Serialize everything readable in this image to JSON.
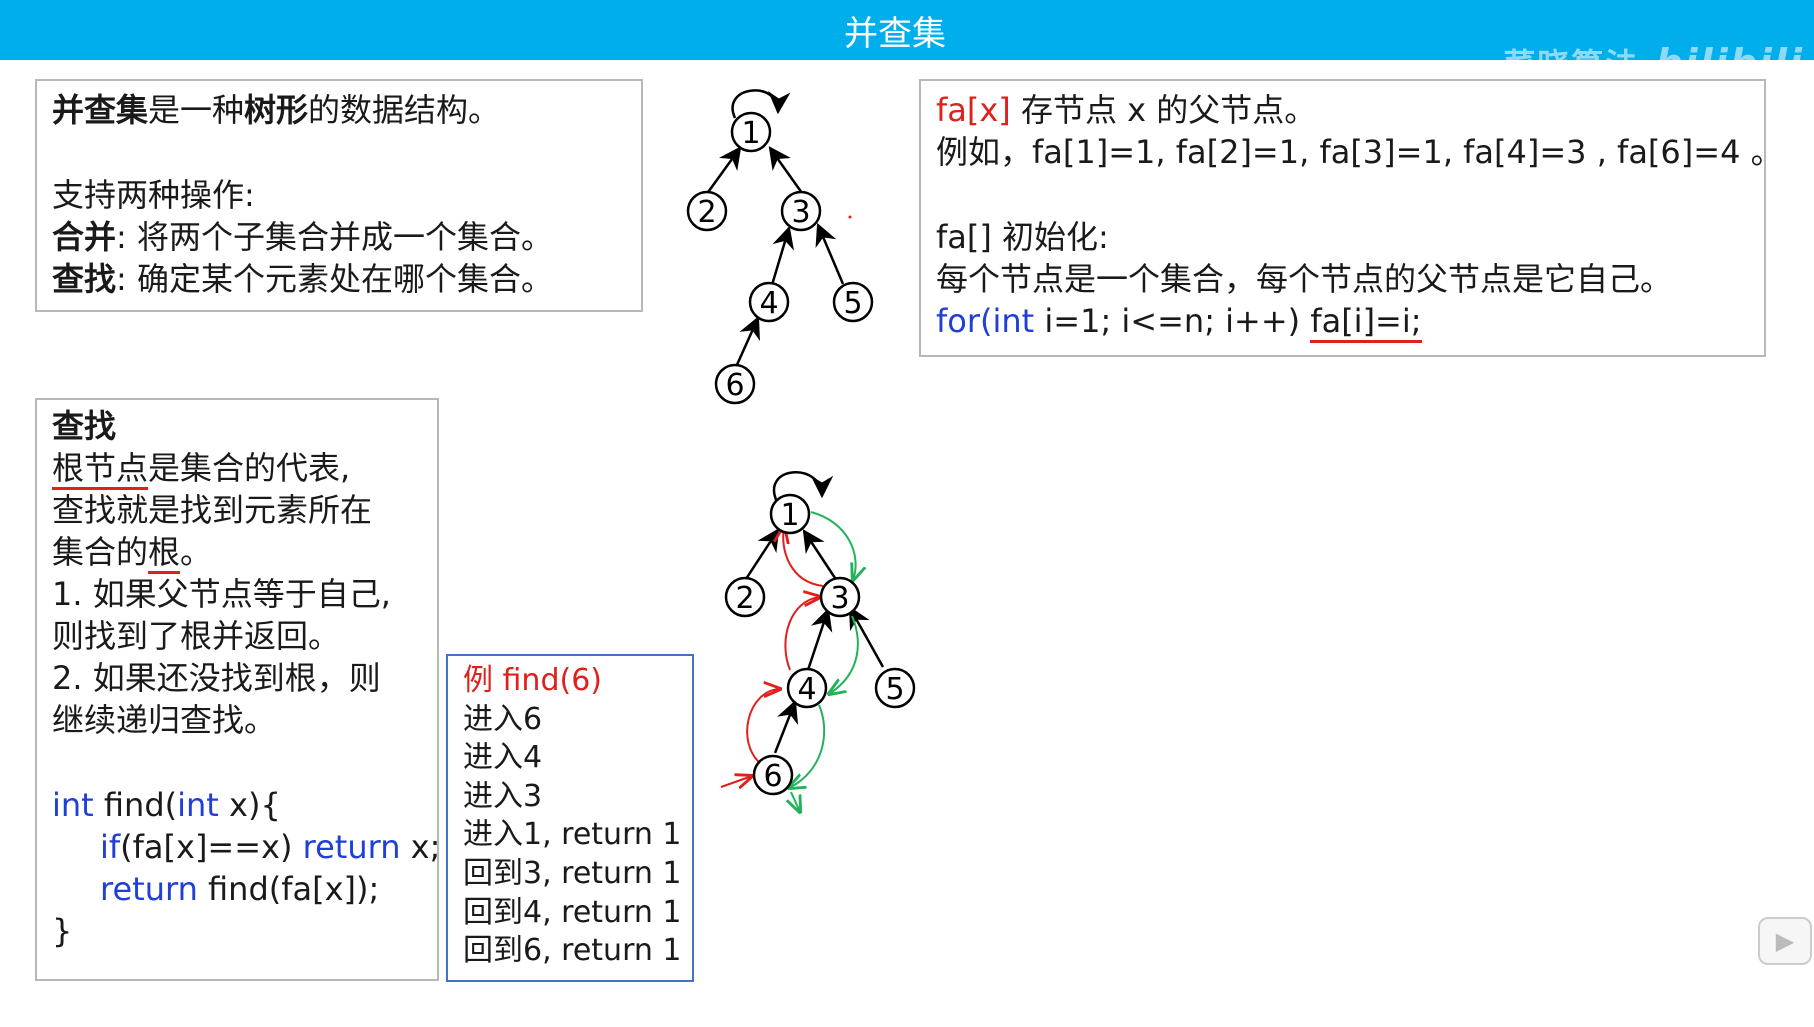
{
  "title": "并查集",
  "watermark": {
    "text": "菜晓算法",
    "logo": "bilibili"
  },
  "intro": {
    "line1_b1": "并查集",
    "line1_t1": "是一种",
    "line1_b2": "树形",
    "line1_t2": "的数据结构。",
    "line2": "支持两种操作:",
    "line3_b": "合并",
    "line3_t": ":  将两个子集合并成一个集合。",
    "line4_b": "查找",
    "line4_t": ":  确定某个元素处在哪个集合。"
  },
  "fa_box": {
    "l1_red": "fa[x]",
    "l1_rest": " 存节点 x 的父节点。",
    "l2": "例如，fa[1]=1, fa[2]=1, fa[3]=1, fa[4]=3 , fa[6]=4 。",
    "l3": "fa[] 初始化:",
    "l4": "每个节点是一个集合，每个节点的父节点是它自己。",
    "l5_kw1": "for",
    "l5_p1": "(",
    "l5_kw2": "int",
    "l5_p2": " i=1; i<=n; i++) ",
    "l5_u": "fa[i]=i;"
  },
  "find_box": {
    "heading": "查找",
    "l1_u": "根节点",
    "l1_t": "是集合的代表,",
    "l2": "查找就是找到元素所在",
    "l3_t": "集合的",
    "l3_u": "根",
    "l3_end": "。",
    "l4": "1. 如果父节点等于自己,",
    "l5": "则找到了根并返回。",
    "l6": "2. 如果还没找到根，则",
    "l7": "继续递归查找。",
    "c1_kw1": "int",
    "c1_t1": " find(",
    "c1_kw2": "int",
    "c1_t2": " x){",
    "c2_kw": "if",
    "c2_t1": "(fa[x]==x) ",
    "c2_kw2": "return",
    "c2_t2": " x;",
    "c3_kw": "return",
    "c3_t": " find(fa[x]);",
    "c4": "}"
  },
  "example_box": {
    "head": "例 find(6)",
    "steps": [
      "进入6",
      "进入4",
      "进入3",
      "进入1, return 1",
      "回到3, return 1",
      "回到4, return 1",
      "回到6, return 1"
    ]
  },
  "tree1": {
    "nodes": [
      "1",
      "2",
      "3",
      "4",
      "5",
      "6"
    ]
  },
  "tree2": {
    "nodes": [
      "1",
      "2",
      "3",
      "4",
      "5",
      "6"
    ]
  },
  "colors": {
    "title_bar": "#00aeec",
    "red": "#e0201c",
    "keyword": "#1f3fd8",
    "green": "#22b35a",
    "box_border": "#b8b8b8",
    "example_border": "#4472c4"
  }
}
